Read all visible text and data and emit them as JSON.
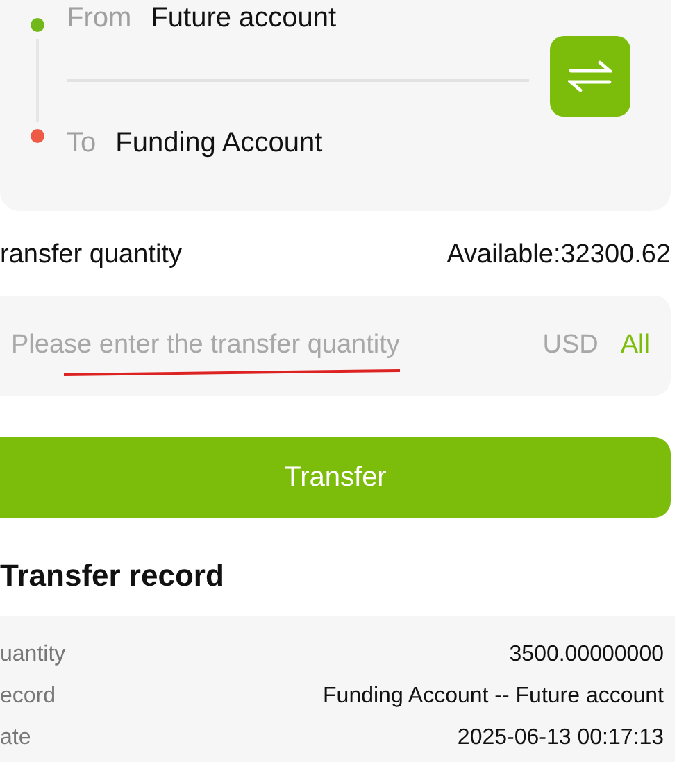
{
  "route": {
    "from": {
      "label": "From",
      "account": "Future account",
      "color": "#72b81a"
    },
    "to": {
      "label": "To",
      "account": "Funding Account",
      "color": "#ee5a45"
    }
  },
  "quantity": {
    "label": "ransfer quantity",
    "available": "Available:32300.62",
    "placeholder": "Please enter the transfer quantity",
    "currency": "USD",
    "all": "All"
  },
  "transfer_button": "Transfer",
  "record": {
    "title": "Transfer record",
    "rows": [
      {
        "label": "uantity",
        "value": "3500.00000000"
      },
      {
        "label": "ecord",
        "value": "Funding Account -- Future account"
      },
      {
        "label": "ate",
        "value": "2025-06-13 00:17:13"
      }
    ]
  }
}
